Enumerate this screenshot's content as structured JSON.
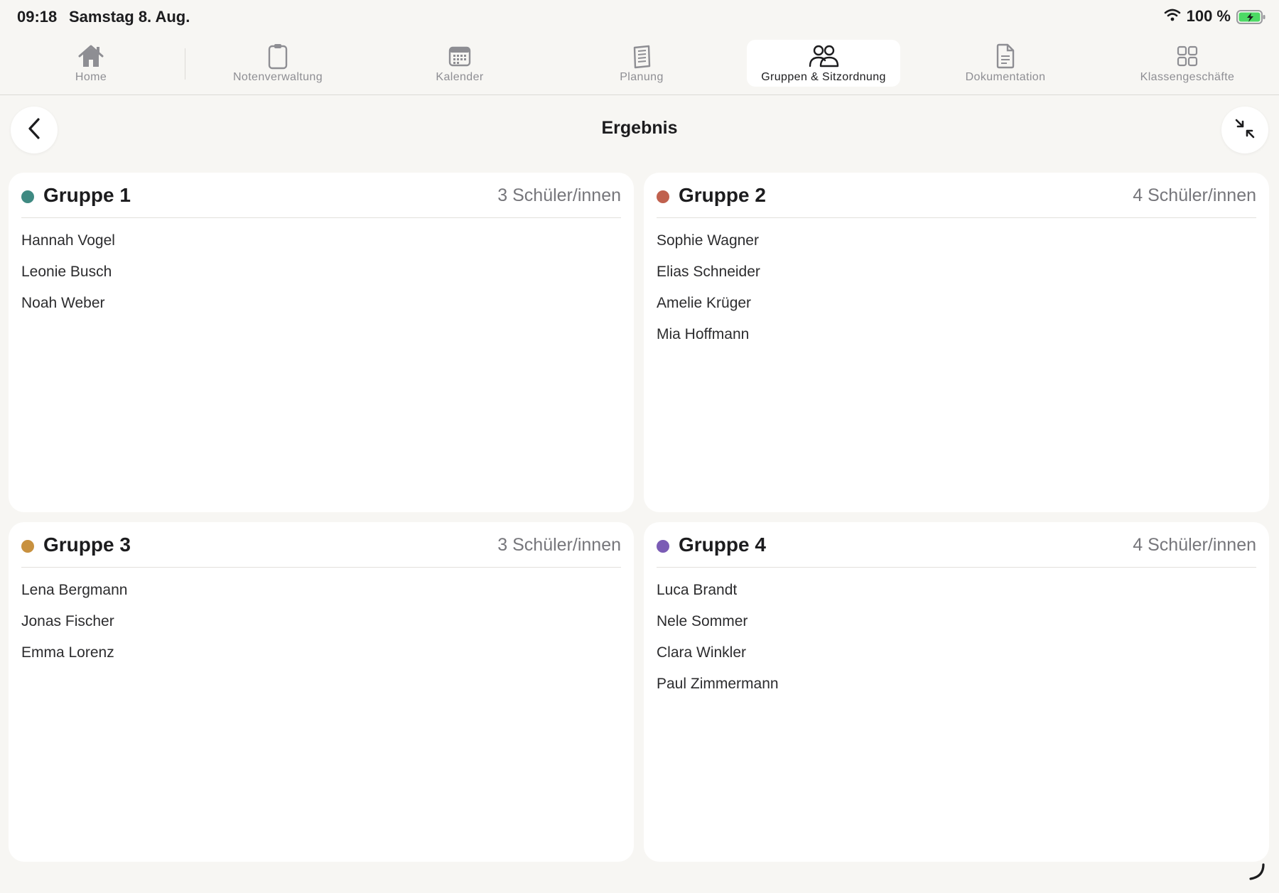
{
  "status": {
    "time": "09:18",
    "date": "Samstag 8. Aug.",
    "battery": "100 %"
  },
  "tabs": [
    {
      "label": "Home",
      "icon": "home-icon"
    },
    {
      "label": "Notenverwaltung",
      "icon": "clipboard-icon"
    },
    {
      "label": "Kalender",
      "icon": "calendar-icon"
    },
    {
      "label": "Planung",
      "icon": "notebook-icon"
    },
    {
      "label": "Gruppen & Sitzordnung",
      "icon": "people-icon",
      "active": true
    },
    {
      "label": "Dokumentation",
      "icon": "document-icon"
    },
    {
      "label": "Klassengeschäfte",
      "icon": "grid-icon"
    }
  ],
  "page": {
    "title": "Ergebnis"
  },
  "groups": [
    {
      "title": "Gruppe 1",
      "count": "3 Schüler/innen",
      "color": "#3f8a82",
      "students": [
        "Hannah Vogel",
        "Leonie Busch",
        "Noah Weber"
      ]
    },
    {
      "title": "Gruppe 2",
      "count": "4 Schüler/innen",
      "color": "#c0614e",
      "students": [
        "Sophie Wagner",
        "Elias Schneider",
        "Amelie Krüger",
        "Mia Hoffmann"
      ]
    },
    {
      "title": "Gruppe 3",
      "count": "3 Schüler/innen",
      "color": "#c8913f",
      "students": [
        "Lena Bergmann",
        "Jonas Fischer",
        "Emma Lorenz"
      ]
    },
    {
      "title": "Gruppe 4",
      "count": "4 Schüler/innen",
      "color": "#7b5cb5",
      "students": [
        "Luca Brandt",
        "Nele Sommer",
        "Clara Winkler",
        "Paul Zimmermann"
      ]
    }
  ],
  "colors": {
    "background": "#f7f6f3",
    "card": "#ffffff",
    "battery_green": "#4cd964",
    "inactive_tab": "#8e8e93"
  }
}
